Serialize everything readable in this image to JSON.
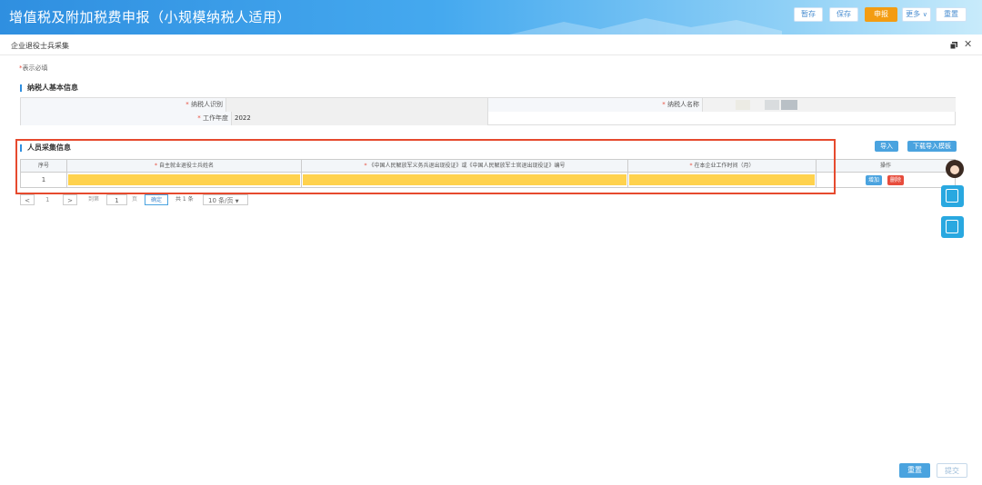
{
  "header": {
    "title": "增值税及附加税费申报（小规模纳税人适用）",
    "buttons": {
      "temp_save": "暂存",
      "save": "保存",
      "declare": "申报",
      "more": "更多",
      "reset": "重置"
    }
  },
  "subheader": {
    "form_name": "企业退役士兵采集"
  },
  "required_note": {
    "star": "*",
    "text": "表示必填"
  },
  "basic_info": {
    "title": "纳税人基本信息",
    "taxpayer_id_label": "纳税人识别",
    "taxpayer_id_value": "",
    "taxpayer_name_label": "纳税人名称",
    "taxpayer_name_value": "",
    "work_year_label": "工作年度",
    "work_year_value": "2022"
  },
  "personnel": {
    "title": "人员采集信息",
    "import_label": "导入",
    "download_template_label": "下载导入模板",
    "columns": {
      "index": "序号",
      "name": "自主就业退役士兵姓名",
      "certificate": "《中国人民解放军义务兵退出现役证》或《中国人民解放军士官退出现役证》编号",
      "work_months": "在本企业工作时间（月）",
      "action": "操作"
    },
    "rows": [
      {
        "index": "1",
        "name": "",
        "certificate": "",
        "work_months": ""
      }
    ],
    "row_actions": {
      "add": "增加",
      "delete": "删除"
    }
  },
  "pagination": {
    "current_page": "1",
    "goto_prefix": "到第",
    "goto_value": "1",
    "goto_suffix": "页",
    "confirm": "确定",
    "total": "共 1 条",
    "page_size": "10 条/页"
  },
  "footer": {
    "reset": "重置",
    "submit": "提交"
  },
  "colors": {
    "accent": "#2f8fe0",
    "highlight_frame": "#e64a2e",
    "required_fill": "#ffd24d",
    "declare": "#f39c12"
  }
}
